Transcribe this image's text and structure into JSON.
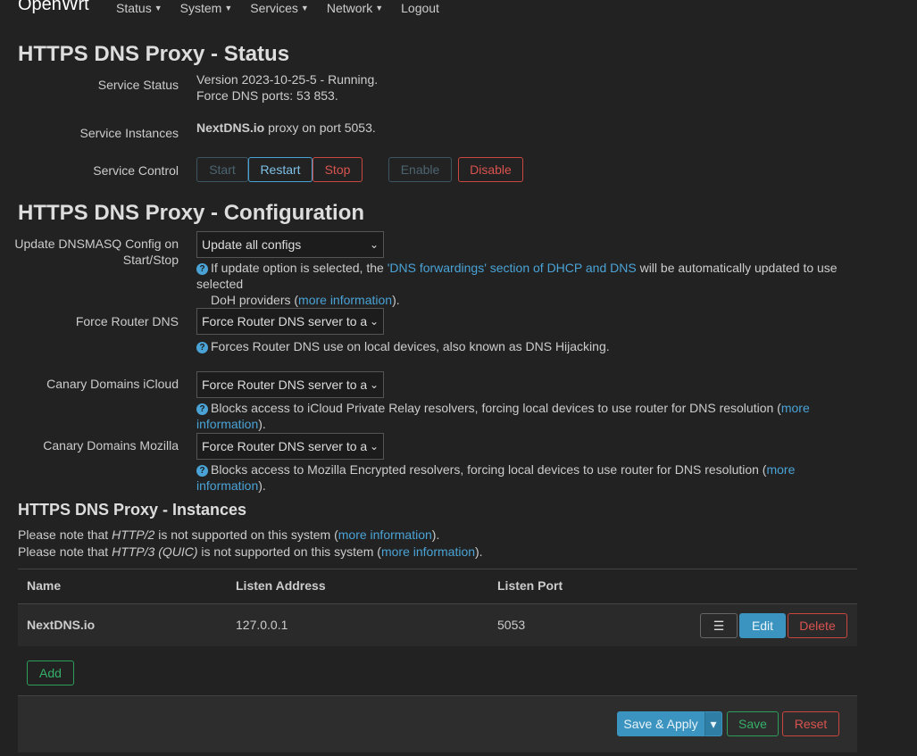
{
  "nav": {
    "brand": "OpenWrt",
    "menus": [
      "Status",
      "System",
      "Services",
      "Network"
    ],
    "logout": "Logout"
  },
  "status": {
    "title": "HTTPS DNS Proxy - Status",
    "service_status_label": "Service Status",
    "service_status_line1": "Version 2023-10-25-5 - Running.",
    "service_status_line2": "Force DNS ports: 53 853.",
    "instances_label": "Service Instances",
    "instances_name": "NextDNS.io",
    "instances_rest": " proxy on port 5053.",
    "control_label": "Service Control",
    "buttons": {
      "start": "Start",
      "restart": "Restart",
      "stop": "Stop",
      "enable": "Enable",
      "disable": "Disable"
    }
  },
  "config": {
    "title": "HTTPS DNS Proxy - Configuration",
    "dnsmasq": {
      "label_line1": "Update DNSMASQ Config on",
      "label_line2": "Start/Stop",
      "value": "Update all configs",
      "hint_pre": "If update option is selected, the ",
      "hint_link": "'DNS forwardings' section of DHCP and DNS",
      "hint_mid": " will be automatically updated to use selected",
      "hint_pre2": "DoH providers (",
      "hint_link2": "more information",
      "hint_post2": ")."
    },
    "force_dns": {
      "label": "Force Router DNS",
      "value": "Force Router DNS server to all local devices",
      "hint": "Forces Router DNS use on local devices, also known as DNS Hijacking."
    },
    "icloud": {
      "label": "Canary Domains iCloud",
      "value": "Force Router DNS server to all local devices",
      "hint_pre": "Blocks access to iCloud Private Relay resolvers, forcing local devices to use router for DNS resolution (",
      "hint_link": "more information",
      "hint_post": ")."
    },
    "mozilla": {
      "label": "Canary Domains Mozilla",
      "value": "Force Router DNS server to all local devices",
      "hint_pre": "Blocks access to Mozilla Encrypted resolvers, forcing local devices to use router for DNS resolution (",
      "hint_link": "more information",
      "hint_post": ")."
    }
  },
  "instances": {
    "title": "HTTPS DNS Proxy - Instances",
    "note1_pre": "Please note that ",
    "note1_em": "HTTP/2",
    "note1_mid": " is not supported on this system (",
    "note1_link": "more information",
    "note1_post": ").",
    "note2_pre": "Please note that ",
    "note2_em": "HTTP/3 (QUIC)",
    "note2_mid": " is not supported on this system (",
    "note2_link": "more information",
    "note2_post": ").",
    "headers": {
      "name": "Name",
      "address": "Listen Address",
      "port": "Listen Port"
    },
    "rows": [
      {
        "name": "NextDNS.io",
        "address": "127.0.0.1",
        "port": "5053"
      }
    ],
    "row_buttons": {
      "menu": "☰",
      "edit": "Edit",
      "delete": "Delete"
    },
    "add": "Add"
  },
  "footer": {
    "save_apply": "Save & Apply",
    "dropdown": "▾",
    "save": "Save",
    "reset": "Reset"
  }
}
